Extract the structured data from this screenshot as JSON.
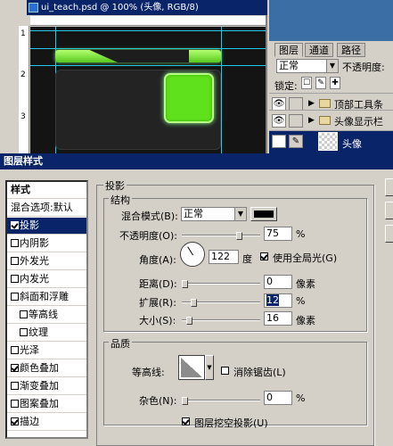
{
  "document": {
    "title": "ui_teach.psd @ 100% (头像, RGB/8)",
    "ruler_marks": [
      "1",
      "2",
      "3"
    ]
  },
  "layers_panel": {
    "tabs": [
      "图层",
      "通道",
      "路径"
    ],
    "blend_mode": "正常",
    "opacity_label": "不透明度:",
    "lock_label": "锁定:",
    "lock_icons": [
      "☐",
      "✎",
      "✚"
    ],
    "layers": [
      {
        "name": "顶部工具条",
        "type": "group",
        "visible": true
      },
      {
        "name": "头像显示栏",
        "type": "group",
        "visible": true
      },
      {
        "name": "头像",
        "type": "layer",
        "visible": true,
        "selected": true
      }
    ]
  },
  "dialog": {
    "title": "图层样式",
    "style_list": [
      {
        "label": "样式",
        "checkbox": false
      },
      {
        "label": "混合选项:默认",
        "checkbox": false
      },
      {
        "label": "投影",
        "checkbox": true,
        "checked": true,
        "selected": true
      },
      {
        "label": "内阴影",
        "checkbox": true,
        "checked": false
      },
      {
        "label": "外发光",
        "checkbox": true,
        "checked": false
      },
      {
        "label": "内发光",
        "checkbox": true,
        "checked": false
      },
      {
        "label": "斜面和浮雕",
        "checkbox": true,
        "checked": false
      },
      {
        "label": "等高线",
        "checkbox": true,
        "checked": false,
        "indent": true
      },
      {
        "label": "纹理",
        "checkbox": true,
        "checked": false,
        "indent": true
      },
      {
        "label": "光泽",
        "checkbox": true,
        "checked": false
      },
      {
        "label": "颜色叠加",
        "checkbox": true,
        "checked": true
      },
      {
        "label": "渐变叠加",
        "checkbox": true,
        "checked": false
      },
      {
        "label": "图案叠加",
        "checkbox": true,
        "checked": false
      },
      {
        "label": "描边",
        "checkbox": true,
        "checked": true
      }
    ],
    "section_title": "投影",
    "structure_title": "结构",
    "blend_mode_label": "混合模式(B):",
    "blend_mode_value": "正常",
    "opacity_label": "不透明度(O):",
    "opacity_value": "75",
    "opacity_unit": "%",
    "angle_label": "角度(A):",
    "angle_value": "122",
    "angle_unit": "度",
    "global_light_label": "使用全局光(G)",
    "global_light_checked": true,
    "distance_label": "距离(D):",
    "distance_value": "0",
    "distance_unit": "像素",
    "spread_label": "扩展(R):",
    "spread_value": "12",
    "spread_unit": "%",
    "size_label": "大小(S):",
    "size_value": "16",
    "size_unit": "像素",
    "quality_title": "品质",
    "contour_label": "等高线:",
    "antialias_label": "消除锯齿(L)",
    "noise_label": "杂色(N):",
    "noise_value": "0",
    "noise_unit": "%",
    "knockout_label": "图层挖空投影(U)",
    "knockout_checked": true,
    "slider_levels": {
      "opacity": 0.75,
      "distance": 0,
      "spread": 0.12,
      "size": 0.064,
      "noise": 0
    }
  },
  "colors": {
    "accent_green": "#5fe11c",
    "guide_cyan": "#24c8ea",
    "title_blue": "#0a246a"
  }
}
